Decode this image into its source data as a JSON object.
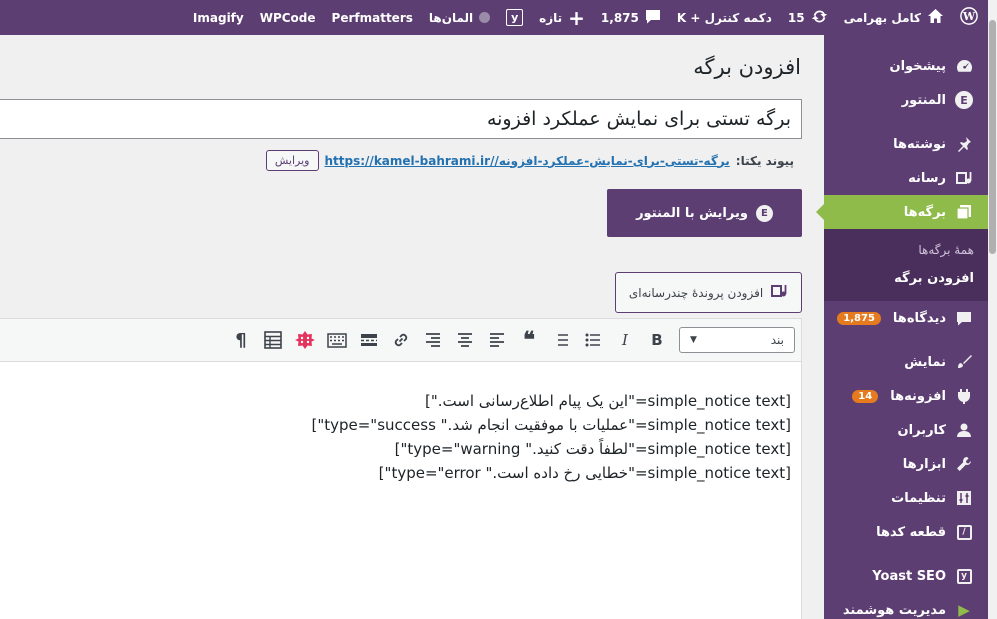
{
  "adminbar": {
    "site_name": "کامل بهرامی",
    "updates_count": "15",
    "control_button": "دکمه کنترل + K",
    "comments_count": "1,875",
    "new_label": "تازه",
    "elements_label": "المان‌ها",
    "perfmatters": "Perfmatters",
    "wpcode": "WPCode",
    "imagify": "Imagify"
  },
  "sidebar": {
    "items": [
      {
        "label": "پیشخوان",
        "icon": "dashboard-icon"
      },
      {
        "label": "المنتور",
        "icon": "elementor-icon"
      },
      {
        "label": "نوشته‌ها",
        "icon": "pin-icon"
      },
      {
        "label": "رسانه",
        "icon": "media-icon"
      },
      {
        "label": "برگه‌ها",
        "icon": "pages-icon"
      },
      {
        "label": "دیدگاه‌ها",
        "icon": "comment-icon",
        "badge": "1,875"
      },
      {
        "label": "نمایش",
        "icon": "brush-icon"
      },
      {
        "label": "افزونه‌ها",
        "icon": "plugin-icon",
        "badge": "14"
      },
      {
        "label": "کاربران",
        "icon": "user-icon"
      },
      {
        "label": "ابزارها",
        "icon": "wrench-icon"
      },
      {
        "label": "تنظیمات",
        "icon": "settings-icon"
      },
      {
        "label": "قطعه کدها",
        "icon": "code-icon"
      },
      {
        "label": "Yoast SEO",
        "icon": "yoast-icon"
      },
      {
        "label": "مدیریت هوشمند",
        "icon": "smart-icon"
      }
    ],
    "submenu": {
      "all_pages": "همهٔ برگه‌ها",
      "add_page": "افزودن برگه"
    }
  },
  "main": {
    "page_title": "افزودن برگه",
    "title_value": "برگه تستی برای نمایش عملکرد افزونه",
    "permalink": {
      "label": "پیوند یکتا:",
      "base_url": "https://kamel-bahrami.ir/",
      "slug": "برگه-تستی-برای-نمایش-عملکرد-افزونه/",
      "edit_label": "ویرایش"
    },
    "elementor_button": "ویرایش با المنتور",
    "media_button": "افزودن پروندهٔ چندرسانه‌ای"
  },
  "editor": {
    "format_select": "بند",
    "content_lines": [
      "[simple_notice text=\"این یک پیام اطلاع‌رسانی است.\"]",
      "[simple_notice text=\"عملیات با موفقیت انجام شد.\" type=\"success\"]",
      "[simple_notice text=\"لطفاً دقت کنید.\" type=\"warning\"]",
      "[simple_notice text=\"خطایی رخ داده است.\" type=\"error\"]"
    ]
  }
}
